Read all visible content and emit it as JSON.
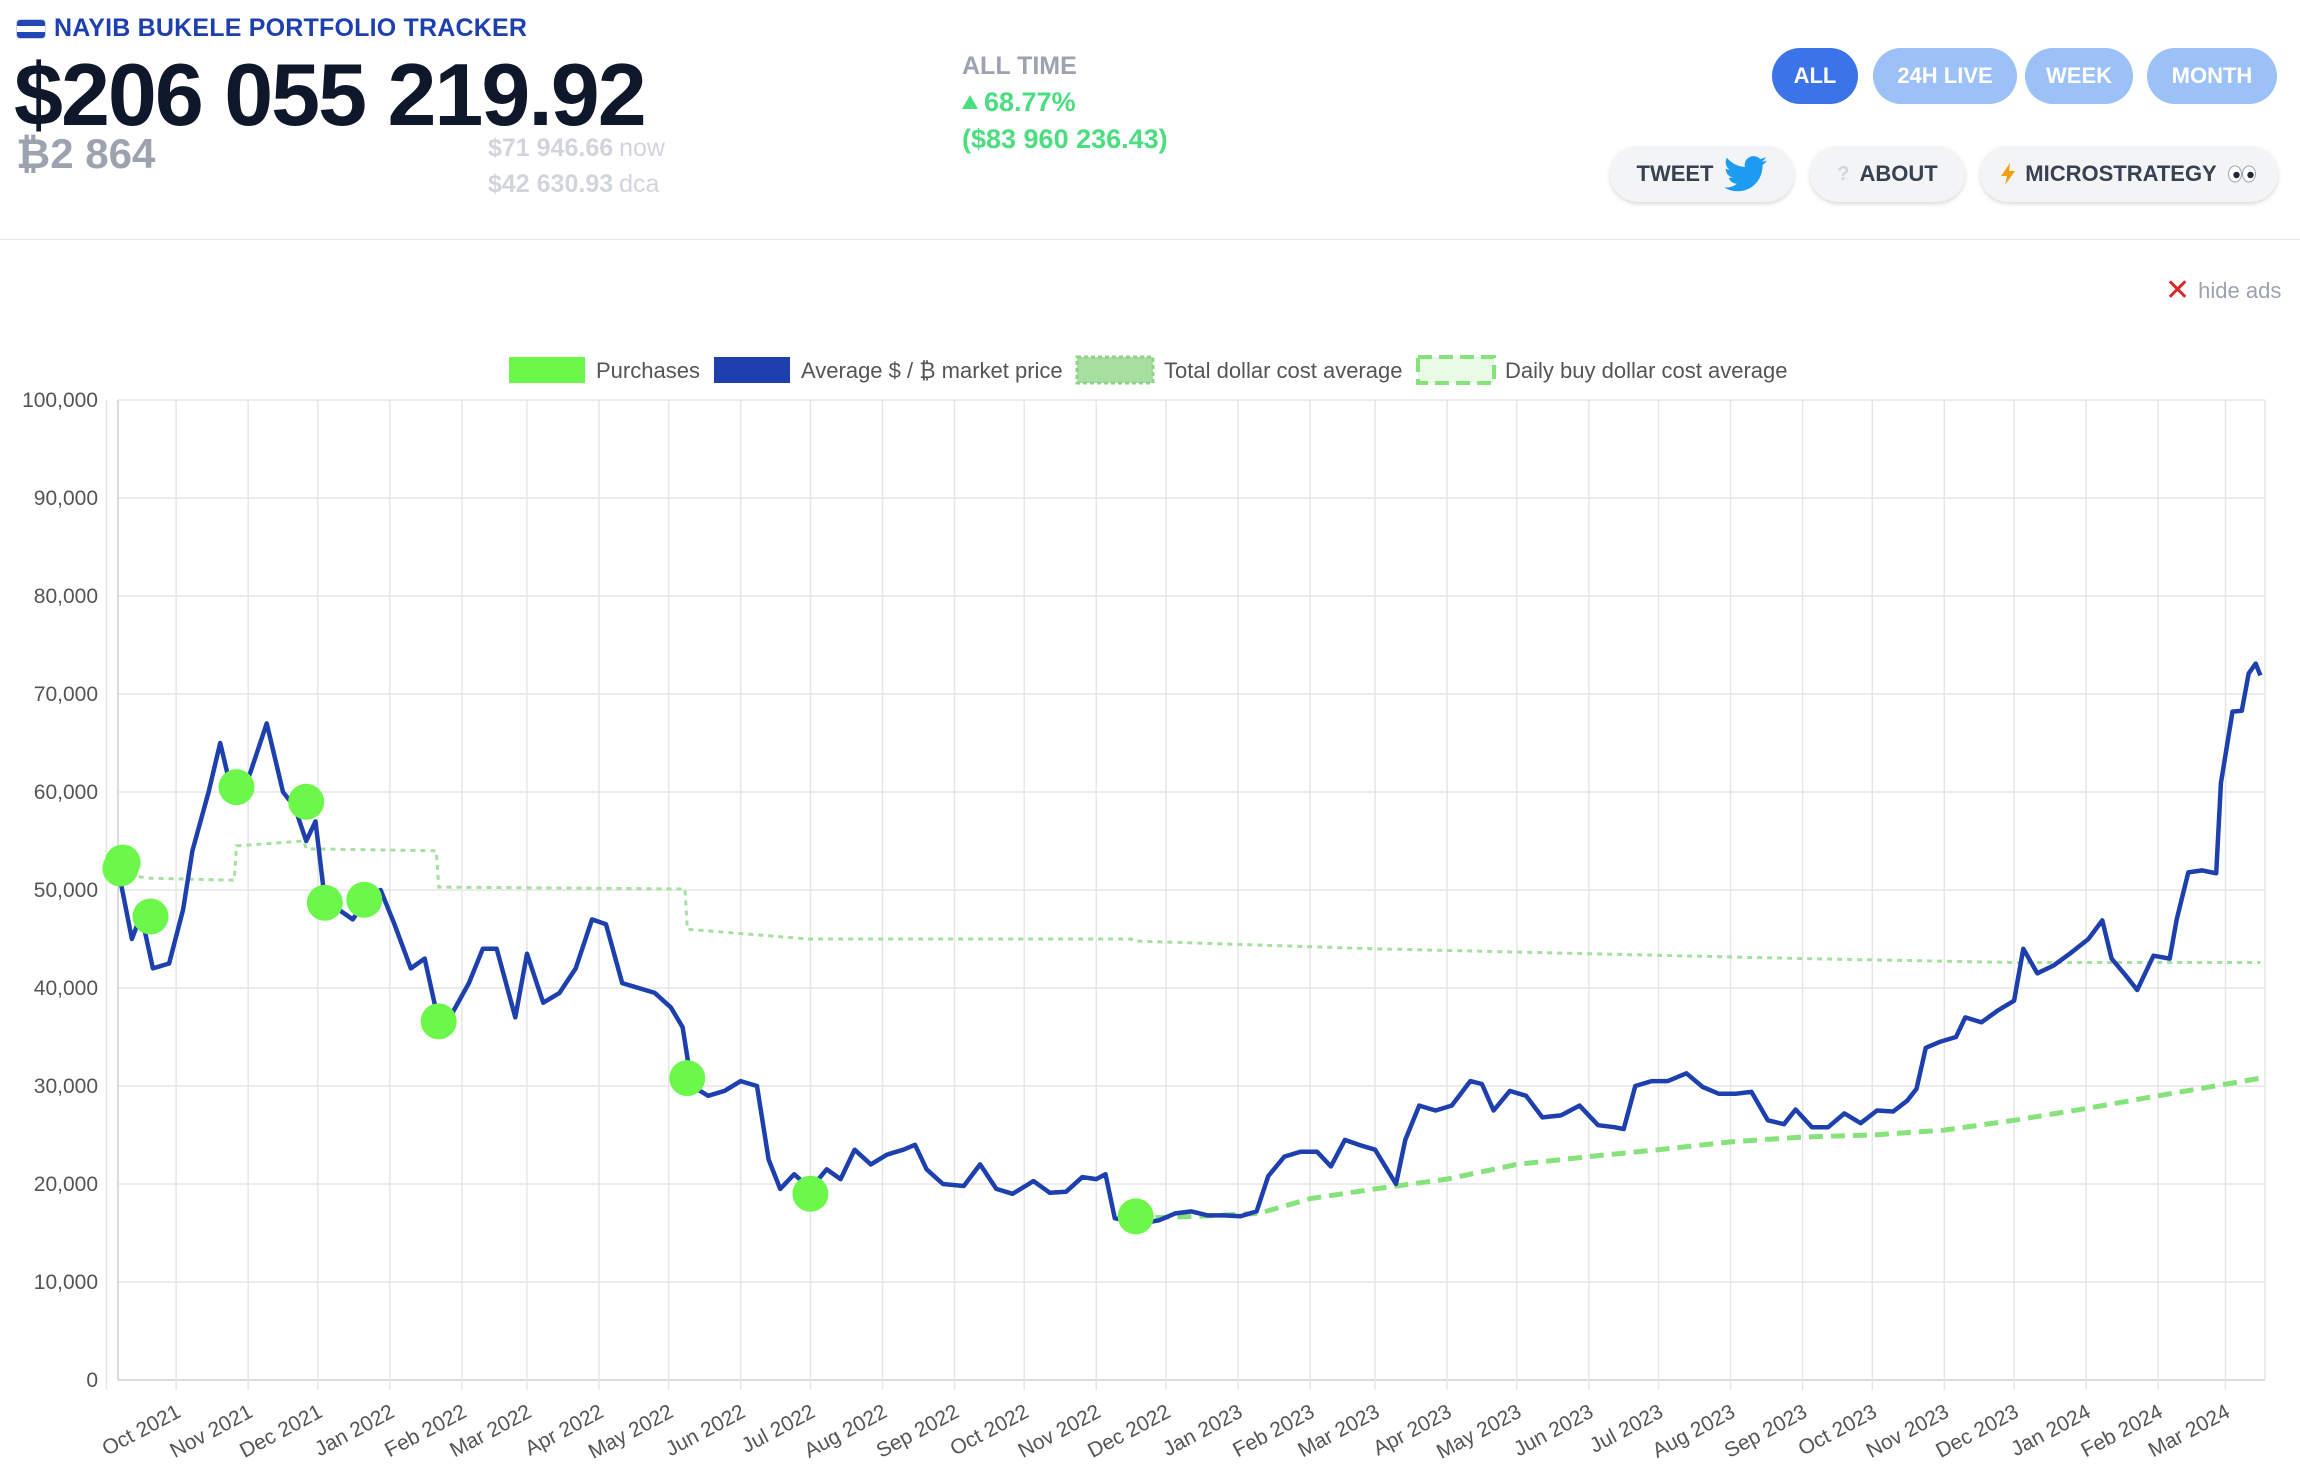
{
  "header": {
    "title": "NAYIB BUKELE PORTFOLIO TRACKER",
    "total_value": "$206 055 219.92",
    "btc_amount": "₿2 864",
    "price_now": "$71 946.66",
    "price_now_unit": "now",
    "price_dca": "$42 630.93",
    "price_dca_unit": "dca",
    "alltime_label": "ALL TIME",
    "alltime_pct": "68.77%",
    "alltime_usd": "($83 960 236.43)"
  },
  "range_buttons": [
    {
      "label": "ALL",
      "active": true
    },
    {
      "label": "24H LIVE",
      "active": false
    },
    {
      "label": "WEEK",
      "active": false
    },
    {
      "label": "MONTH",
      "active": false
    }
  ],
  "actions": {
    "tweet": "TWEET",
    "about": "ABOUT",
    "microstrategy": "MICROSTRATEGY"
  },
  "ads": {
    "hide_label": "hide ads"
  },
  "colors": {
    "accent": "#3b74e8",
    "accent_light": "#9cc1f6",
    "positive": "#4ade80",
    "price_line": "#1e40af",
    "purchases": "#6cf84a",
    "total_dca": "#a7dfa0",
    "daily_dca": "#86e27a"
  },
  "chart_data": {
    "type": "line",
    "title": "",
    "xlabel": "",
    "ylabel": "",
    "ylim": [
      0,
      100000
    ],
    "grid": true,
    "legend_position": "top",
    "y_ticks": [
      0,
      10000,
      20000,
      30000,
      40000,
      50000,
      60000,
      70000,
      80000,
      90000,
      100000
    ],
    "y_tick_labels": [
      "0",
      "10,000",
      "20,000",
      "30,000",
      "40,000",
      "50,000",
      "60,000",
      "70,000",
      "80,000",
      "90,000",
      "100,000"
    ],
    "x_tick_labels": [
      "Oct 2021",
      "Nov 2021",
      "Dec 2021",
      "Jan 2022",
      "Feb 2022",
      "Mar 2022",
      "Apr 2022",
      "May 2022",
      "Jun 2022",
      "Jul 2022",
      "Aug 2022",
      "Sep 2022",
      "Oct 2022",
      "Nov 2022",
      "Dec 2022",
      "Jan 2023",
      "Feb 2023",
      "Mar 2023",
      "Apr 2023",
      "May 2023",
      "Jun 2023",
      "Jul 2023",
      "Aug 2023",
      "Sep 2023",
      "Oct 2023",
      "Nov 2023",
      "Dec 2023",
      "Jan 2024",
      "Feb 2024",
      "Mar 2024"
    ],
    "legend": [
      {
        "name": "Purchases",
        "style": "circle"
      },
      {
        "name": "Average $ / ₿ market price",
        "style": "line"
      },
      {
        "name": "Total dollar cost average",
        "style": "dotted"
      },
      {
        "name": "Daily buy dollar cost average",
        "style": "dashed"
      }
    ],
    "series": [
      {
        "name": "Average $ / ₿ market price",
        "points": [
          [
            "2021-09-07",
            51000
          ],
          [
            "2021-09-12",
            45000
          ],
          [
            "2021-09-16",
            47500
          ],
          [
            "2021-09-21",
            42000
          ],
          [
            "2021-09-28",
            42500
          ],
          [
            "2021-10-04",
            48000
          ],
          [
            "2021-10-08",
            54000
          ],
          [
            "2021-10-15",
            60000
          ],
          [
            "2021-10-20",
            65000
          ],
          [
            "2021-10-24",
            61000
          ],
          [
            "2021-10-28",
            59000
          ],
          [
            "2021-11-02",
            62000
          ],
          [
            "2021-11-09",
            67000
          ],
          [
            "2021-11-12",
            64000
          ],
          [
            "2021-11-16",
            60000
          ],
          [
            "2021-11-21",
            58500
          ],
          [
            "2021-11-26",
            55000
          ],
          [
            "2021-11-30",
            57000
          ],
          [
            "2021-12-04",
            49000
          ],
          [
            "2021-12-10",
            48000
          ],
          [
            "2021-12-16",
            47000
          ],
          [
            "2021-12-22",
            49000
          ],
          [
            "2021-12-28",
            50000
          ],
          [
            "2022-01-03",
            46500
          ],
          [
            "2022-01-10",
            42000
          ],
          [
            "2022-01-16",
            43000
          ],
          [
            "2022-01-22",
            36500
          ],
          [
            "2022-01-28",
            37500
          ],
          [
            "2022-02-04",
            40500
          ],
          [
            "2022-02-10",
            44000
          ],
          [
            "2022-02-16",
            44000
          ],
          [
            "2022-02-24",
            37000
          ],
          [
            "2022-03-01",
            43500
          ],
          [
            "2022-03-08",
            38500
          ],
          [
            "2022-03-15",
            39500
          ],
          [
            "2022-03-22",
            42000
          ],
          [
            "2022-03-29",
            47000
          ],
          [
            "2022-04-04",
            46500
          ],
          [
            "2022-04-11",
            40500
          ],
          [
            "2022-04-18",
            40000
          ],
          [
            "2022-04-25",
            39500
          ],
          [
            "2022-05-02",
            38000
          ],
          [
            "2022-05-07",
            36000
          ],
          [
            "2022-05-11",
            30000
          ],
          [
            "2022-05-18",
            29000
          ],
          [
            "2022-05-25",
            29500
          ],
          [
            "2022-06-01",
            30500
          ],
          [
            "2022-06-08",
            30000
          ],
          [
            "2022-06-13",
            22500
          ],
          [
            "2022-06-18",
            19500
          ],
          [
            "2022-06-24",
            21000
          ],
          [
            "2022-07-01",
            19500
          ],
          [
            "2022-07-08",
            21500
          ],
          [
            "2022-07-14",
            20500
          ],
          [
            "2022-07-20",
            23500
          ],
          [
            "2022-07-27",
            22000
          ],
          [
            "2022-08-03",
            23000
          ],
          [
            "2022-08-10",
            23500
          ],
          [
            "2022-08-15",
            24000
          ],
          [
            "2022-08-20",
            21500
          ],
          [
            "2022-08-27",
            20000
          ],
          [
            "2022-09-05",
            19800
          ],
          [
            "2022-09-12",
            22000
          ],
          [
            "2022-09-19",
            19500
          ],
          [
            "2022-09-26",
            19000
          ],
          [
            "2022-10-05",
            20300
          ],
          [
            "2022-10-12",
            19100
          ],
          [
            "2022-10-19",
            19200
          ],
          [
            "2022-10-26",
            20700
          ],
          [
            "2022-11-01",
            20500
          ],
          [
            "2022-11-05",
            21000
          ],
          [
            "2022-11-09",
            16500
          ],
          [
            "2022-11-14",
            16300
          ],
          [
            "2022-11-21",
            16000
          ],
          [
            "2022-11-28",
            16300
          ],
          [
            "2022-12-05",
            17000
          ],
          [
            "2022-12-12",
            17200
          ],
          [
            "2022-12-19",
            16800
          ],
          [
            "2022-12-26",
            16800
          ],
          [
            "2023-01-02",
            16700
          ],
          [
            "2023-01-09",
            17200
          ],
          [
            "2023-01-14",
            20800
          ],
          [
            "2023-01-21",
            22800
          ],
          [
            "2023-01-28",
            23300
          ],
          [
            "2023-02-04",
            23300
          ],
          [
            "2023-02-10",
            21800
          ],
          [
            "2023-02-16",
            24500
          ],
          [
            "2023-02-22",
            24000
          ],
          [
            "2023-03-01",
            23500
          ],
          [
            "2023-03-10",
            20000
          ],
          [
            "2023-03-14",
            24500
          ],
          [
            "2023-03-20",
            28000
          ],
          [
            "2023-03-27",
            27500
          ],
          [
            "2023-04-03",
            28000
          ],
          [
            "2023-04-11",
            30500
          ],
          [
            "2023-04-16",
            30200
          ],
          [
            "2023-04-21",
            27500
          ],
          [
            "2023-04-28",
            29500
          ],
          [
            "2023-05-05",
            29000
          ],
          [
            "2023-05-12",
            26800
          ],
          [
            "2023-05-20",
            27000
          ],
          [
            "2023-05-28",
            28000
          ],
          [
            "2023-06-05",
            26000
          ],
          [
            "2023-06-12",
            25800
          ],
          [
            "2023-06-16",
            25600
          ],
          [
            "2023-06-21",
            30000
          ],
          [
            "2023-06-28",
            30500
          ],
          [
            "2023-07-05",
            30500
          ],
          [
            "2023-07-13",
            31300
          ],
          [
            "2023-07-20",
            29900
          ],
          [
            "2023-07-27",
            29200
          ],
          [
            "2023-08-03",
            29200
          ],
          [
            "2023-08-10",
            29400
          ],
          [
            "2023-08-17",
            26500
          ],
          [
            "2023-08-24",
            26100
          ],
          [
            "2023-08-29",
            27600
          ],
          [
            "2023-09-05",
            25800
          ],
          [
            "2023-09-12",
            25800
          ],
          [
            "2023-09-19",
            27200
          ],
          [
            "2023-09-26",
            26200
          ],
          [
            "2023-10-03",
            27500
          ],
          [
            "2023-10-10",
            27400
          ],
          [
            "2023-10-16",
            28500
          ],
          [
            "2023-10-20",
            29700
          ],
          [
            "2023-10-24",
            33900
          ],
          [
            "2023-10-30",
            34500
          ],
          [
            "2023-11-06",
            35000
          ],
          [
            "2023-11-10",
            37000
          ],
          [
            "2023-11-17",
            36500
          ],
          [
            "2023-11-24",
            37700
          ],
          [
            "2023-12-01",
            38700
          ],
          [
            "2023-12-05",
            44000
          ],
          [
            "2023-12-11",
            41500
          ],
          [
            "2023-12-18",
            42300
          ],
          [
            "2023-12-25",
            43500
          ],
          [
            "2024-01-02",
            45000
          ],
          [
            "2024-01-08",
            46900
          ],
          [
            "2024-01-12",
            43000
          ],
          [
            "2024-01-18",
            41300
          ],
          [
            "2024-01-23",
            39800
          ],
          [
            "2024-01-30",
            43300
          ],
          [
            "2024-02-06",
            43000
          ],
          [
            "2024-02-09",
            47000
          ],
          [
            "2024-02-14",
            51800
          ],
          [
            "2024-02-20",
            52000
          ],
          [
            "2024-02-26",
            51700
          ],
          [
            "2024-02-28",
            60900
          ],
          [
            "2024-03-04",
            68200
          ],
          [
            "2024-03-08",
            68300
          ],
          [
            "2024-03-11",
            72100
          ],
          [
            "2024-03-14",
            73100
          ],
          [
            "2024-03-16",
            71900
          ]
        ]
      },
      {
        "name": "Total dollar cost average",
        "points": [
          [
            "2021-09-07",
            52000
          ],
          [
            "2021-09-10",
            51500
          ],
          [
            "2021-09-20",
            51200
          ],
          [
            "2021-10-26",
            51000
          ],
          [
            "2021-10-27",
            54500
          ],
          [
            "2021-11-25",
            55000
          ],
          [
            "2021-11-26",
            54200
          ],
          [
            "2022-01-21",
            54000
          ],
          [
            "2022-01-22",
            50300
          ],
          [
            "2022-05-08",
            50100
          ],
          [
            "2022-05-09",
            46000
          ],
          [
            "2022-06-30",
            45000
          ],
          [
            "2022-11-16",
            45000
          ],
          [
            "2022-11-17",
            44800
          ],
          [
            "2023-03-01",
            44000
          ],
          [
            "2023-06-01",
            43500
          ],
          [
            "2023-09-01",
            43000
          ],
          [
            "2023-12-01",
            42600
          ],
          [
            "2024-03-16",
            42600
          ]
        ]
      },
      {
        "name": "Daily buy dollar cost average",
        "points": [
          [
            "2022-11-17",
            16500
          ],
          [
            "2022-12-15",
            16700
          ],
          [
            "2023-01-10",
            17000
          ],
          [
            "2023-02-01",
            18500
          ],
          [
            "2023-03-01",
            19500
          ],
          [
            "2023-04-01",
            20500
          ],
          [
            "2023-05-01",
            22000
          ],
          [
            "2023-06-01",
            22800
          ],
          [
            "2023-07-01",
            23500
          ],
          [
            "2023-08-01",
            24300
          ],
          [
            "2023-09-01",
            24800
          ],
          [
            "2023-10-01",
            25000
          ],
          [
            "2023-11-01",
            25500
          ],
          [
            "2023-12-01",
            26500
          ],
          [
            "2024-01-01",
            27700
          ],
          [
            "2024-02-01",
            29000
          ],
          [
            "2024-03-16",
            30800
          ]
        ]
      }
    ],
    "purchases": [
      [
        "2021-09-07",
        52200
      ],
      [
        "2021-09-08",
        52800
      ],
      [
        "2021-09-20",
        47300
      ],
      [
        "2021-10-27",
        60500
      ],
      [
        "2021-11-26",
        59000
      ],
      [
        "2021-12-04",
        48700
      ],
      [
        "2021-12-21",
        49000
      ],
      [
        "2022-01-22",
        36600
      ],
      [
        "2022-05-09",
        30800
      ],
      [
        "2022-07-01",
        19000
      ],
      [
        "2022-11-18",
        16700
      ]
    ]
  }
}
